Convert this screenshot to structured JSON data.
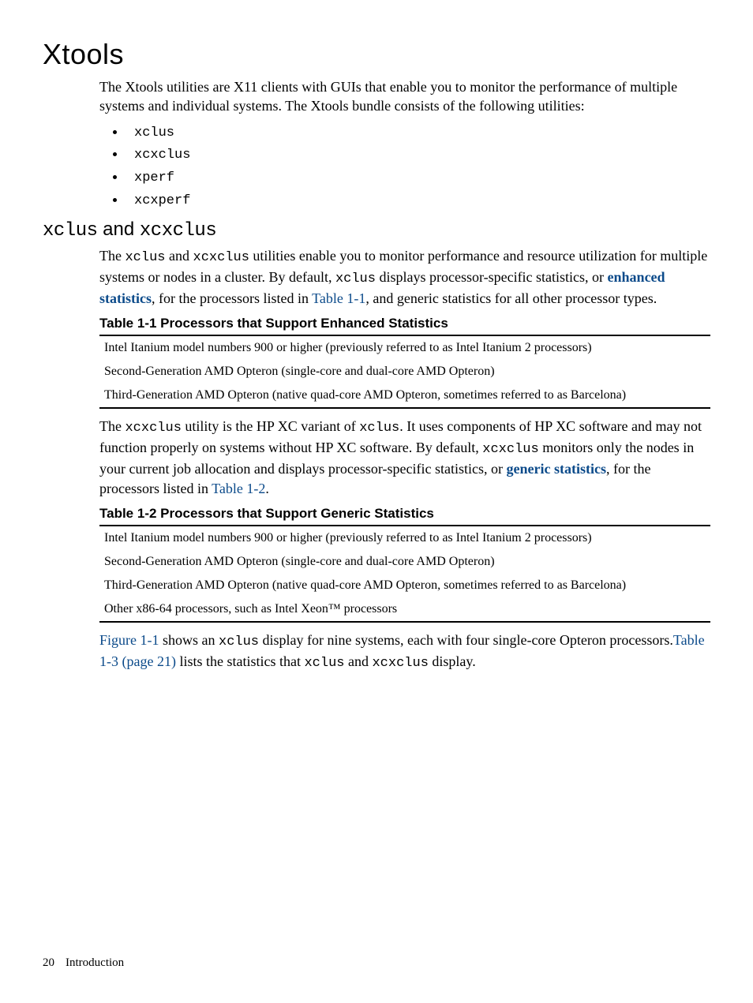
{
  "section_title": "Xtools",
  "intro_para": "The Xtools utilities are X11 clients with GUIs that enable you to monitor the performance of multiple systems and individual systems. The Xtools bundle consists of the following utilities:",
  "util_list": [
    "xclus",
    "xcxclus",
    "xperf",
    "xcxperf"
  ],
  "subhead": {
    "m1": "xclus",
    "conj": " and ",
    "m2": "xcxclus"
  },
  "para2": {
    "t1": "The ",
    "m1": "xclus",
    "t2": " and ",
    "m2": "xcxclus",
    "t3": " utilities enable you to monitor performance and resource utilization for multiple systems or nodes in a cluster. By default, ",
    "m3": "xclus",
    "t4": " displays processor-specific statistics, or ",
    "l1": "enhanced statistics",
    "t5": ", for the processors listed in ",
    "l2": "Table 1-1",
    "t6": ", and generic statistics for all other processor types."
  },
  "table1": {
    "title": "Table 1-1 Processors that Support Enhanced Statistics",
    "rows": [
      "Intel Itanium model numbers 900 or higher (previously referred to as Intel Itanium 2 processors)",
      "Second-Generation AMD Opteron (single-core and dual-core AMD Opteron)",
      "Third-Generation AMD Opteron (native quad-core AMD Opteron, sometimes referred to as Barcelona)"
    ]
  },
  "para3": {
    "t1": "The ",
    "m1": "xcxclus",
    "t2": " utility is the HP XC variant of ",
    "m2": "xclus",
    "t3": ". It uses components of HP XC software and may not function properly on systems without HP XC software. By default, ",
    "m3": "xcxclus",
    "t4": " monitors only the nodes in your current job allocation and displays processor-specific statistics, or ",
    "l1": "generic statistics",
    "t5": ", for the processors listed in ",
    "l2": "Table 1-2",
    "t6": "."
  },
  "table2": {
    "title": "Table 1-2 Processors that Support Generic Statistics",
    "rows": [
      "Intel Itanium model numbers 900 or higher (previously referred to as Intel Itanium 2 processors)",
      "Second-Generation AMD Opteron (single-core and dual-core AMD Opteron)",
      "Third-Generation AMD Opteron (native quad-core AMD Opteron, sometimes referred to as Barcelona)",
      "Other x86-64 processors, such as Intel Xeon™ processors"
    ]
  },
  "para4": {
    "l1": "Figure 1-1",
    "t1": " shows an ",
    "m1": "xclus",
    "t2": " display for nine systems, each with four single-core Opteron processors.",
    "l2": "Table 1-3 (page 21)",
    "t3": " lists the statistics that ",
    "m2": "xclus",
    "t4": " and ",
    "m3": "xcxclus",
    "t5": " display."
  },
  "footer": {
    "page": "20",
    "chapter": "Introduction"
  }
}
